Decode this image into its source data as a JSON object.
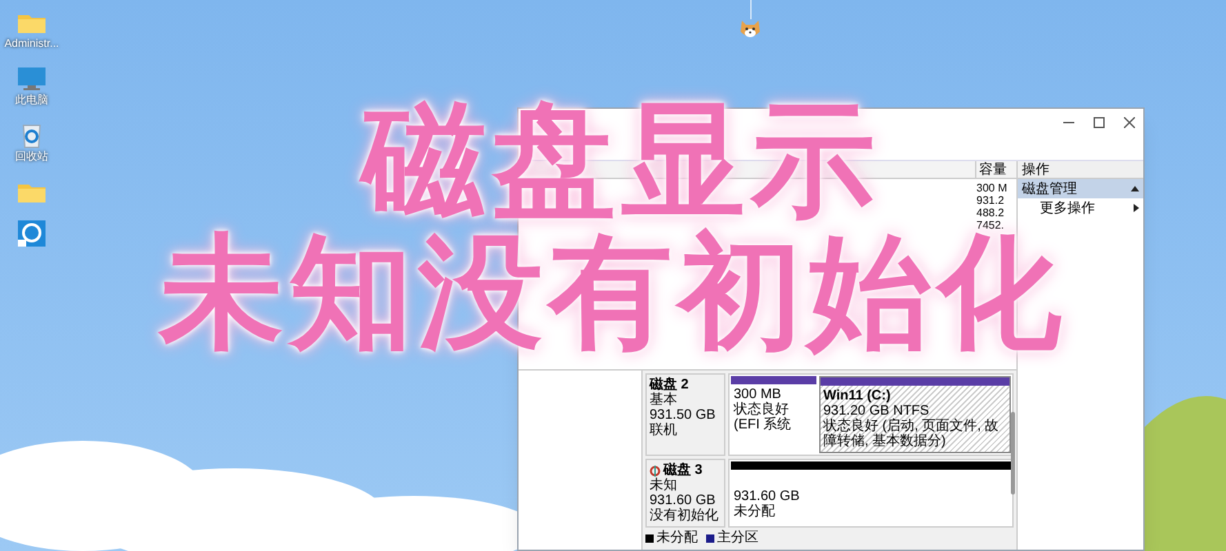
{
  "desktop_icons": [
    {
      "kind": "folder",
      "label": "Administr..."
    },
    {
      "kind": "computer",
      "label": "此电脑"
    },
    {
      "kind": "recycle",
      "label": "回收站"
    },
    {
      "kind": "folder"
    },
    {
      "kind": "app"
    }
  ],
  "overlay_title": {
    "lines": [
      "磁盘显示",
      "未知没有初始化"
    ]
  },
  "volume_table": {
    "columns": [
      "容量"
    ],
    "rows": [
      {
        "capacity": "300 M"
      },
      {
        "capacity": "931.2"
      },
      {
        "capacity": "488.2"
      },
      {
        "capacity": "7452."
      }
    ]
  },
  "actions": {
    "title": "操作",
    "items": [
      {
        "kind": "group",
        "label": "磁盘管理",
        "selected": true
      },
      {
        "kind": "menu",
        "label": "更多操作",
        "selected": false
      }
    ]
  },
  "disks": [
    {
      "name": "磁盘 2",
      "type": "基本",
      "size": "931.50 GB",
      "state": "联机",
      "initialized": true,
      "partitions": [
        {
          "kind": "primary",
          "selected": false,
          "lines": [
            "300 MB",
            "状态良好 (EFI 系统"
          ]
        },
        {
          "kind": "primary",
          "selected": true,
          "title": "Win11  (C:)",
          "lines": [
            "931.20 GB NTFS",
            "状态良好 (启动, 页面文件, 故障转储, 基本数据分)"
          ]
        }
      ]
    },
    {
      "name": "磁盘 3",
      "type": "未知",
      "size": "931.60 GB",
      "state": "没有初始化",
      "initialized": false,
      "partitions": [
        {
          "kind": "unallocated",
          "selected": false,
          "lines": [
            "931.60 GB",
            "未分配"
          ]
        }
      ]
    }
  ],
  "legend": [
    {
      "label": "未分配",
      "color": "#000000"
    },
    {
      "label": "主分区",
      "color": "#1c1c8a"
    }
  ]
}
